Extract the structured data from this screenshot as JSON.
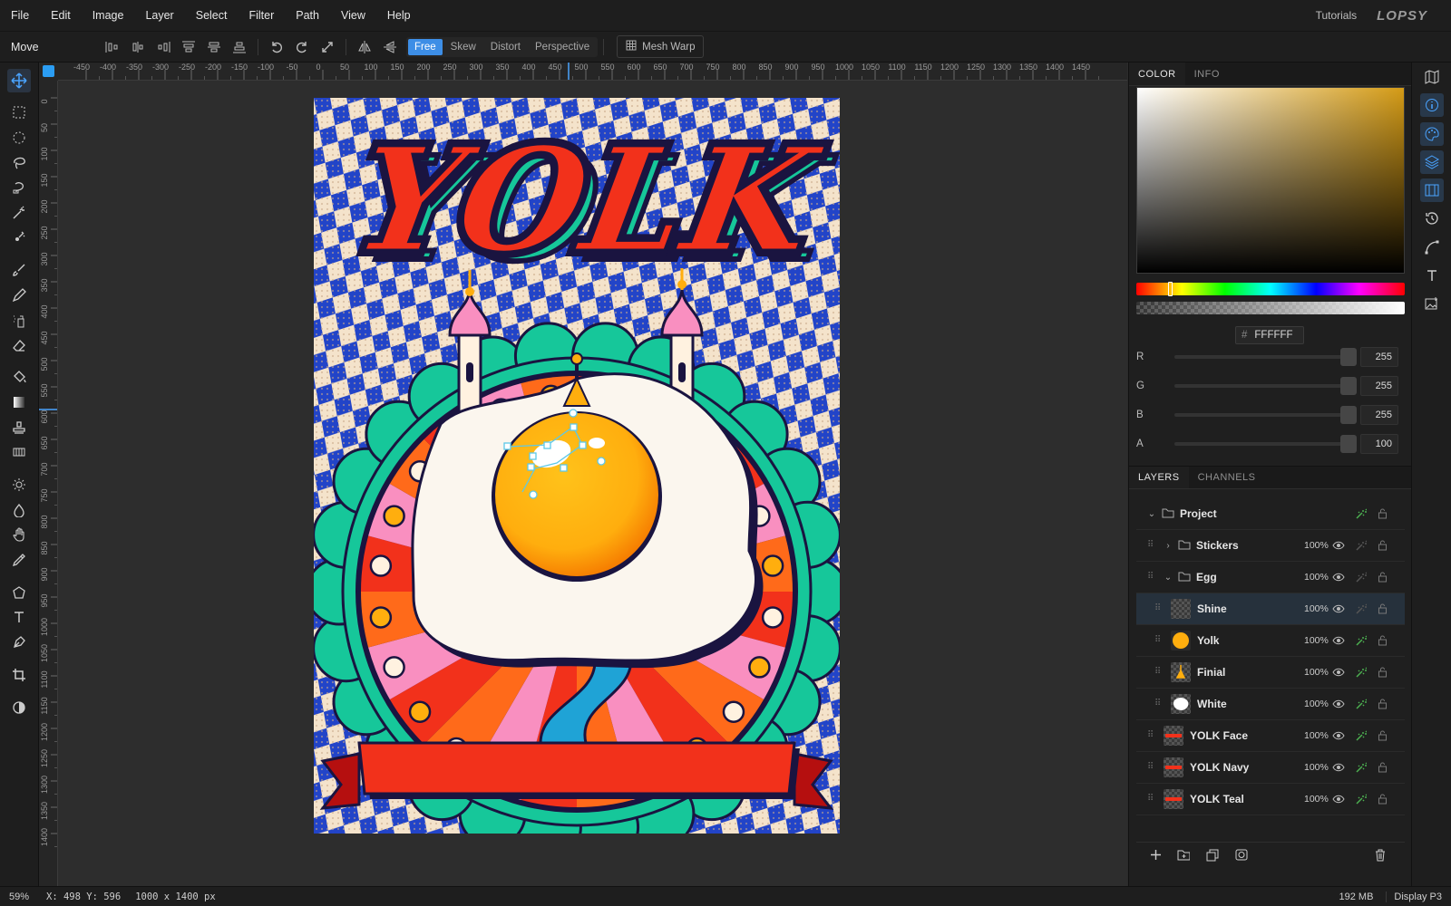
{
  "menu": {
    "items": [
      "File",
      "Edit",
      "Image",
      "Layer",
      "Select",
      "Filter",
      "Path",
      "View",
      "Help"
    ],
    "tutorials": "Tutorials",
    "logo": "LOPSY"
  },
  "options": {
    "tool_name": "Move",
    "transform_modes": [
      "Free",
      "Skew",
      "Distort",
      "Perspective"
    ],
    "active_mode": "Free",
    "mesh_warp": "Mesh Warp"
  },
  "rulers": {
    "h_labels": [
      "-450",
      "-400",
      "-350",
      "-300",
      "-250",
      "-200",
      "-150",
      "-100",
      "-50",
      "0",
      "50",
      "100",
      "150",
      "200",
      "250",
      "300",
      "350",
      "400",
      "450",
      "500",
      "550",
      "600",
      "650",
      "700",
      "750",
      "800",
      "850",
      "900",
      "950",
      "1000",
      "1050",
      "1100",
      "1150",
      "1200",
      "1250",
      "1300",
      "1350",
      "1400",
      "1450"
    ],
    "v_labels": [
      "0",
      "50",
      "100",
      "150",
      "200",
      "250",
      "300",
      "350",
      "400",
      "450",
      "500",
      "550",
      "600",
      "650",
      "700",
      "750",
      "800",
      "850",
      "900",
      "950",
      "1000",
      "1050",
      "1100",
      "1150",
      "1200",
      "1250",
      "1300",
      "1350",
      "1400"
    ]
  },
  "poster": {
    "title": "YOLK"
  },
  "color_panel": {
    "tabs": [
      "COLOR",
      "INFO"
    ],
    "hex_prefix": "#",
    "hex": "FFFFFF",
    "channels": [
      {
        "label": "R",
        "value": "255"
      },
      {
        "label": "G",
        "value": "255"
      },
      {
        "label": "B",
        "value": "255"
      },
      {
        "label": "A",
        "value": "100"
      }
    ],
    "picker_hue": "#d49b16"
  },
  "layers_panel": {
    "tabs": [
      "LAYERS",
      "CHANNELS"
    ],
    "rows": [
      {
        "name": "Project",
        "opacity": ""
      },
      {
        "name": "Stickers",
        "opacity": "100%"
      },
      {
        "name": "Egg",
        "opacity": "100%"
      },
      {
        "name": "Shine",
        "opacity": "100%"
      },
      {
        "name": "Yolk",
        "opacity": "100%"
      },
      {
        "name": "Finial",
        "opacity": "100%"
      },
      {
        "name": "White",
        "opacity": "100%"
      },
      {
        "name": "YOLK Face",
        "opacity": "100%"
      },
      {
        "name": "YOLK Navy",
        "opacity": "100%"
      },
      {
        "name": "YOLK Teal",
        "opacity": "100%"
      }
    ]
  },
  "status": {
    "zoom": "59%",
    "coords": "X: 498 Y: 596",
    "doc_size": "1000 x 1400 px",
    "memory": "192 MB",
    "color_profile": "Display P3"
  },
  "colors": {
    "accent": "#3d8ee6",
    "poster_red": "#f2311b",
    "poster_blue": "#2244c8",
    "poster_teal": "#16c79a",
    "poster_orange": "#ff6a1a",
    "poster_pink": "#f98fc0",
    "yolk": "#ffae0e"
  }
}
